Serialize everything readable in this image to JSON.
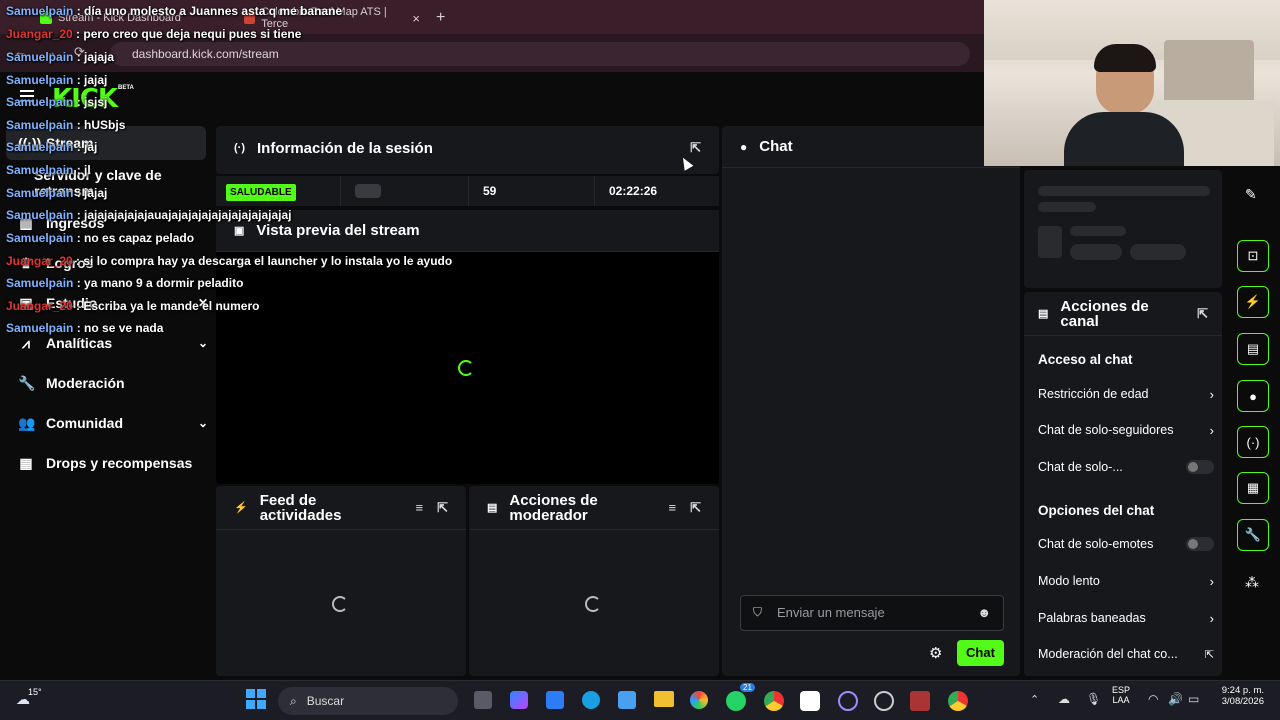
{
  "browser": {
    "tabs": [
      {
        "label": "Stream - Kick Dashboard"
      },
      {
        "label": "Colombia Real Map ATS | Terce"
      }
    ],
    "new_tab": "+",
    "close_tab": "×",
    "url": "dashboard.kick.com/stream"
  },
  "app": {
    "logo": "KICK",
    "logo_badge": "BETA"
  },
  "sidebar": {
    "items": [
      {
        "label": "Stream"
      },
      {
        "label": "Servidor y clave de retransm"
      },
      {
        "label": "Ingresos"
      },
      {
        "label": "Logros"
      },
      {
        "label": "Estudio"
      },
      {
        "label": "Analíticas"
      },
      {
        "label": "Moderación"
      },
      {
        "label": "Comunidad"
      },
      {
        "label": "Drops y recompensas"
      }
    ]
  },
  "session": {
    "title": "Información de la sesión",
    "status": "SALUDABLE",
    "viewers": "59",
    "duration": "02:22:26"
  },
  "preview": {
    "title": "Vista previa del stream"
  },
  "feed": {
    "title_line1": "Feed de",
    "title_line2": "actividades"
  },
  "mod_actions": {
    "title_line1": "Acciones de",
    "title_line2": "moderador"
  },
  "chat": {
    "title": "Chat",
    "input_placeholder": "Enviar un mensaje",
    "send_label": "Chat"
  },
  "channel_actions": {
    "title_line1": "Acciones de",
    "title_line2": "canal",
    "section_access": "Acceso al chat",
    "age_restriction": "Restricción de edad",
    "followers_only": "Chat de solo-seguidores",
    "subs_only": "Chat de solo-...",
    "section_options": "Opciones del chat",
    "emotes_only": "Chat de solo-emotes",
    "slow_mode": "Modo lento",
    "banned_words": "Palabras baneadas",
    "chat_moderation": "Moderación del chat co..."
  },
  "overlay_chat": [
    {
      "user": "Samuelpain",
      "msg": "día uno molesto a Juannes asta q me banane",
      "color": "u1"
    },
    {
      "user": "Juangar_20",
      "msg": "pero creo que deja nequi pues si tiene",
      "color": "u2"
    },
    {
      "user": "Samuelpain",
      "msg": "jajaja",
      "color": "u1"
    },
    {
      "user": "Samuelpain",
      "msg": "jajaj",
      "color": "u1"
    },
    {
      "user": "Samuelpain",
      "msg": "jsjsj",
      "color": "u1"
    },
    {
      "user": "Samuelpain",
      "msg": "hUSbjs",
      "color": "u1"
    },
    {
      "user": "Samuelpain",
      "msg": "jaj",
      "color": "u1"
    },
    {
      "user": "Samuelpain",
      "msg": "jl",
      "color": "u1"
    },
    {
      "user": "Samuelpain",
      "msg": "jajaj",
      "color": "u1"
    },
    {
      "user": "Samuelpain",
      "msg": "jajajajajajajauajajajajajajajajajajajajaj",
      "color": "u1"
    },
    {
      "user": "Samuelpain",
      "msg": "no es capaz pelado",
      "color": "u1"
    },
    {
      "user": "Juangar_20",
      "msg": "si lo compra hay ya descarga el launcher y lo instala yo le ayudo",
      "color": "u2"
    },
    {
      "user": "Samuelpain",
      "msg": "ya mano 9 a dormir peladito",
      "color": "u1"
    },
    {
      "user": "Juangar_20",
      "msg": "Escriba ya le mande el numero",
      "color": "u2"
    },
    {
      "user": "Samuelpain",
      "msg": "no se ve nada",
      "color": "u1"
    }
  ],
  "taskbar": {
    "temperature": "15°",
    "search": "Buscar",
    "lang1": "ESP",
    "lang2": "LAA",
    "time": "9:24 p. m.",
    "date": "3/08/2026",
    "badge_count": "21"
  },
  "colors": {
    "accent": "#53fc18",
    "panel": "#17181b",
    "bg": "#0b0b0c"
  }
}
